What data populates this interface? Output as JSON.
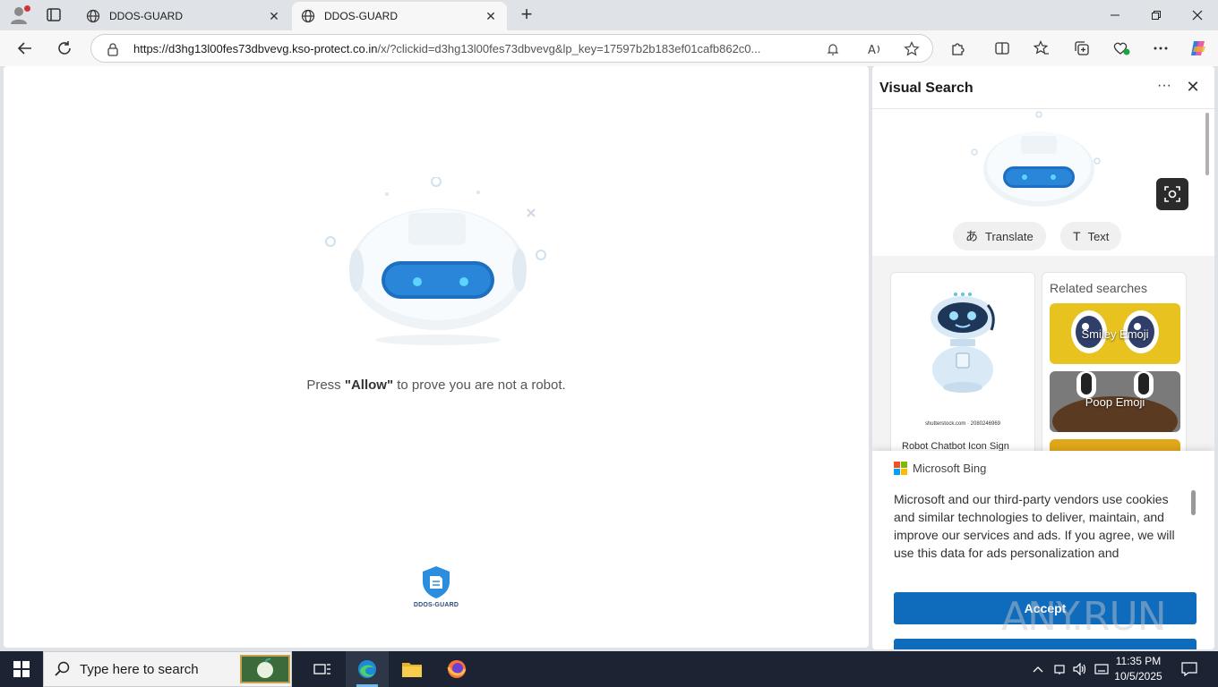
{
  "browser": {
    "tabs": [
      {
        "title": "DDOS-GUARD",
        "active": false
      },
      {
        "title": "DDOS-GUARD",
        "active": true
      }
    ],
    "address": {
      "host": "https://d3hg13l00fes73dbvevg.kso-protect.co.in",
      "path": "/x/?clickid=d3hg13l00fes73dbvevg&lp_key=17597b2b183ef01cafb862c0..."
    }
  },
  "page": {
    "caption_prefix": "Press ",
    "caption_bold": "\"Allow\"",
    "caption_suffix": " to prove you are not a robot.",
    "logo_text": "DDOS-GUARD"
  },
  "visual_search": {
    "title": "Visual Search",
    "chips": [
      {
        "label": "Translate",
        "icon": "translate-icon"
      },
      {
        "label": "Text",
        "icon": "text-icon"
      }
    ],
    "result": {
      "source": "shutterstock.com · 2080246969",
      "title": "Robot Chatbot Icon Sign"
    },
    "related_heading": "Related searches",
    "related": [
      {
        "label": "Smiley Emoji",
        "color": "#e8c21e"
      },
      {
        "label": "Poop Emoji",
        "color": "#5b3a22"
      },
      {
        "label": "",
        "color": "#e0a81a"
      }
    ]
  },
  "consent": {
    "brand": "Microsoft Bing",
    "text": "Microsoft and our third-party vendors use cookies and similar technologies to deliver, maintain, and improve our services and ads. If you agree, we will use this data for ads personalization and",
    "accept_label": "Accept"
  },
  "watermark": "ANY.RUN",
  "taskbar": {
    "search_placeholder": "Type here to search",
    "time": "11:35 PM",
    "date": "10/5/2025"
  },
  "colors": {
    "accent": "#0f6cbd",
    "taskbar": "#1c2433",
    "robot_visor": "#1e6fbf"
  }
}
